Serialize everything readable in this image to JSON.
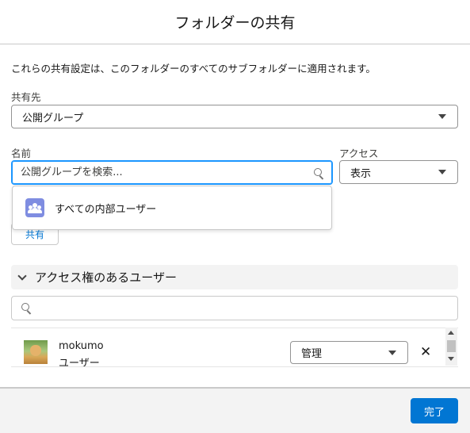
{
  "modal": {
    "title": "フォルダーの共有"
  },
  "description": "これらの共有設定は、このフォルダーのすべてのサブフォルダーに適用されます。",
  "share_with": {
    "label": "共有先",
    "value": "公開グループ"
  },
  "name": {
    "label": "名前",
    "placeholder": "公開グループを検索..."
  },
  "access": {
    "label": "アクセス",
    "value": "表示"
  },
  "dropdown": {
    "items": [
      {
        "label": "すべての内部ユーザー",
        "icon": "group-icon"
      }
    ]
  },
  "share_button": {
    "label": "共有"
  },
  "users_section": {
    "title": "アクセス権のあるユーザー",
    "search_placeholder": ""
  },
  "users": [
    {
      "name": "mokumo",
      "type": "ユーザー",
      "access": "管理"
    }
  ],
  "footer": {
    "done_label": "完了"
  },
  "colors": {
    "brand": "#0176d3",
    "focus_border": "#1b96ff",
    "group_icon_bg": "#7f8de1"
  }
}
